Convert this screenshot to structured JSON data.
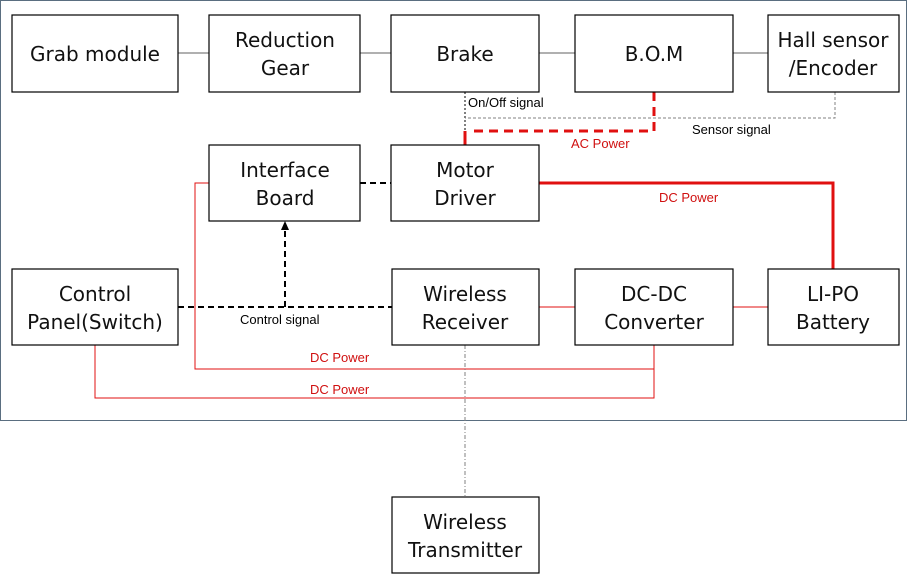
{
  "colors": {
    "power": "#e01010",
    "signal": "#000000",
    "sensor": "#808080",
    "frame": "#5a6e80"
  },
  "boxes": {
    "grab": [
      "Grab  module"
    ],
    "reduction": [
      "Reduction",
      "Gear"
    ],
    "brake": [
      "Brake"
    ],
    "bom": [
      "B.O.M"
    ],
    "hall": [
      "Hall sensor",
      "/Encoder"
    ],
    "interface": [
      "Interface",
      "Board"
    ],
    "motor": [
      "Motor",
      "Driver"
    ],
    "control": [
      "Control",
      "Panel(Switch)"
    ],
    "receiver": [
      "Wireless",
      "Receiver"
    ],
    "dcdc": [
      "DC-DC",
      "Converter"
    ],
    "battery": [
      "LI-PO",
      "Battery"
    ],
    "transmitter": [
      "Wireless",
      "Transmitter"
    ]
  },
  "labels": {
    "onoff": "On/Off signal",
    "sensor": "Sensor signal",
    "ac_power": "AC Power",
    "dc_power_main": "DC Power",
    "control_signal": "Control signal",
    "dc_power_interface": "DC Power",
    "dc_power_panel": "DC Power"
  }
}
